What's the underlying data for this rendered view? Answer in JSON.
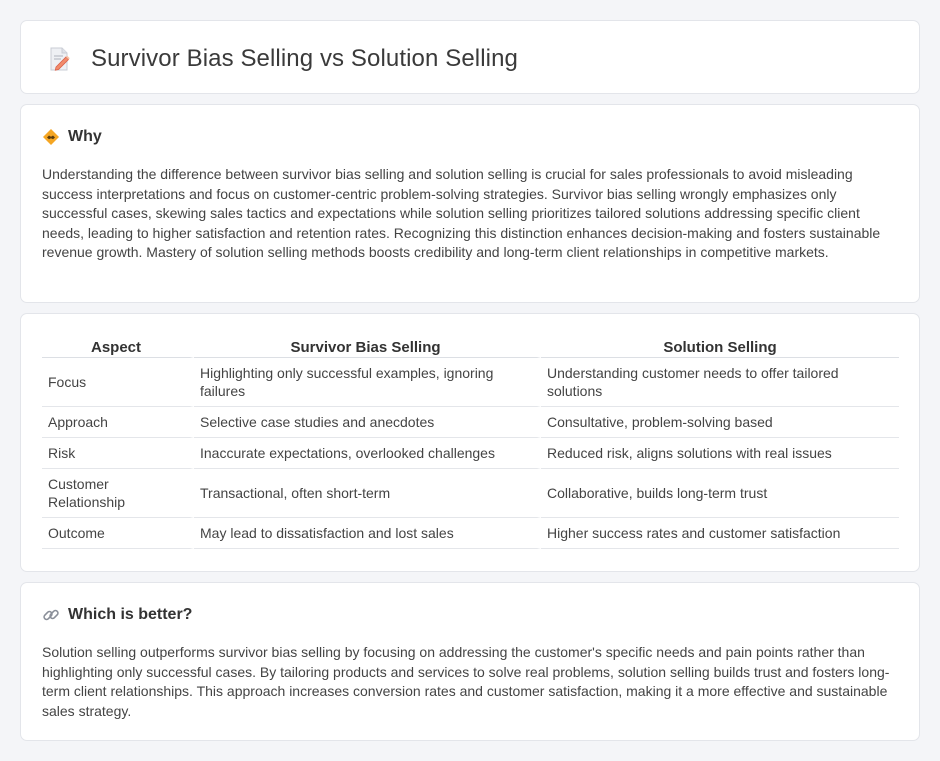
{
  "header": {
    "title": "Survivor Bias Selling vs Solution Selling",
    "icon": "document-pencil-icon"
  },
  "why": {
    "icon": "handshake-diamond-icon",
    "title": "Why",
    "text": "Understanding the difference between survivor bias selling and solution selling is crucial for sales professionals to avoid misleading success interpretations and focus on customer-centric problem-solving strategies. Survivor bias selling wrongly emphasizes only successful cases, skewing sales tactics and expectations while solution selling prioritizes tailored solutions addressing specific client needs, leading to higher satisfaction and retention rates. Recognizing this distinction enhances decision-making and fosters sustainable revenue growth. Mastery of solution selling methods boosts credibility and long-term client relationships in competitive markets."
  },
  "table": {
    "headers": [
      "Aspect",
      "Survivor Bias Selling",
      "Solution Selling"
    ],
    "rows": [
      [
        "Focus",
        "Highlighting only successful examples, ignoring failures",
        "Understanding customer needs to offer tailored solutions"
      ],
      [
        "Approach",
        "Selective case studies and anecdotes",
        "Consultative, problem-solving based"
      ],
      [
        "Risk",
        "Inaccurate expectations, overlooked challenges",
        "Reduced risk, aligns solutions with real issues"
      ],
      [
        "Customer Relationship",
        "Transactional, often short-term",
        "Collaborative, builds long-term trust"
      ],
      [
        "Outcome",
        "May lead to dissatisfaction and lost sales",
        "Higher success rates and customer satisfaction"
      ]
    ]
  },
  "better": {
    "icon": "link-icon",
    "title": "Which is better?",
    "text": "Solution selling outperforms survivor bias selling by focusing on addressing the customer's specific needs and pain points rather than highlighting only successful cases. By tailoring products and services to solve real problems, solution selling builds trust and fosters long-term client relationships. This approach increases conversion rates and customer satisfaction, making it a more effective and sustainable sales strategy."
  },
  "colors": {
    "background": "#f4f5f8",
    "card": "#ffffff",
    "accent_orange": "#f5a623"
  }
}
